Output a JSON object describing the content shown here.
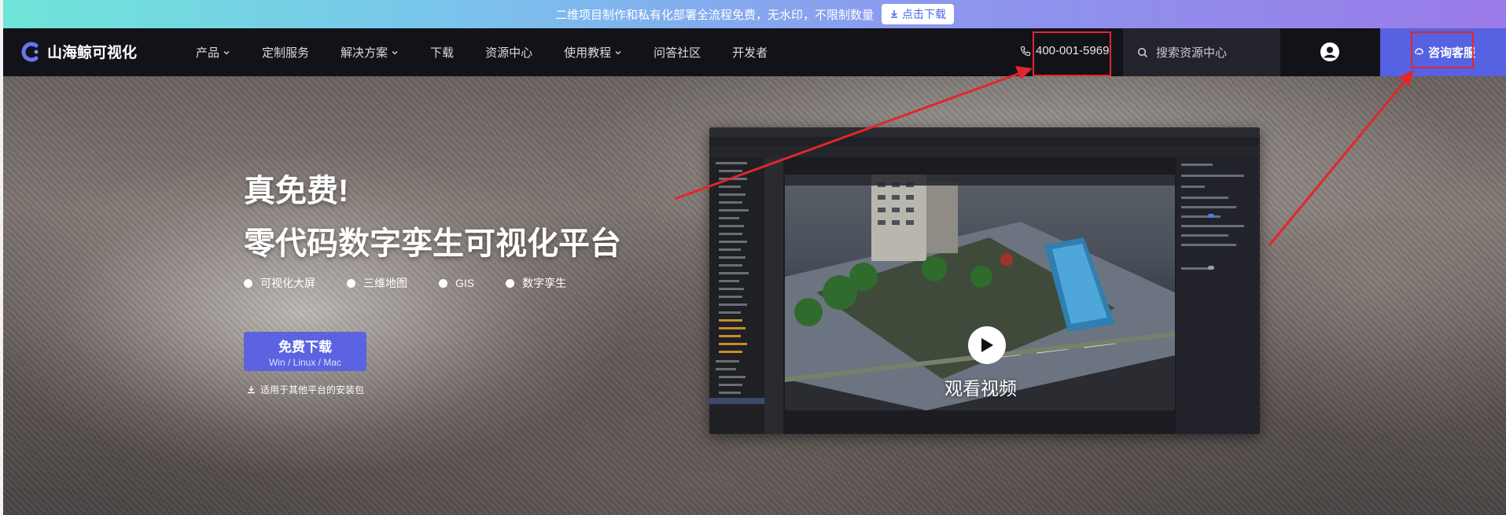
{
  "announcement": {
    "text": "二维项目制作和私有化部署全流程免费，无水印，不限制数量",
    "button_label": "点击下载"
  },
  "nav": {
    "brand": "山海鲸可视化",
    "menu": [
      {
        "label": "产品",
        "dropdown": true
      },
      {
        "label": "定制服务",
        "dropdown": false
      },
      {
        "label": "解决方案",
        "dropdown": true
      },
      {
        "label": "下载",
        "dropdown": false
      },
      {
        "label": "资源中心",
        "dropdown": false
      },
      {
        "label": "使用教程",
        "dropdown": true
      },
      {
        "label": "问答社区",
        "dropdown": false
      },
      {
        "label": "开发者",
        "dropdown": false
      }
    ],
    "phone": "400-001-5969",
    "search_placeholder": "搜索资源中心",
    "consult_label": "咨询客服"
  },
  "hero": {
    "title_line1": "真免费!",
    "title_line2": "零代码数字孪生可视化平台",
    "tags": [
      "可视化大屏",
      "三维地图",
      "GIS",
      "数字孪生"
    ],
    "download_button": {
      "title": "免费下载",
      "subtitle": "Win / Linux / Mac"
    },
    "other_platforms_link": "适用于其他平台的安装包",
    "video_caption": "观看视频"
  },
  "colors": {
    "accent": "#5b63e0",
    "nav_bg": "#121318",
    "annotation_red": "#e3262c"
  }
}
